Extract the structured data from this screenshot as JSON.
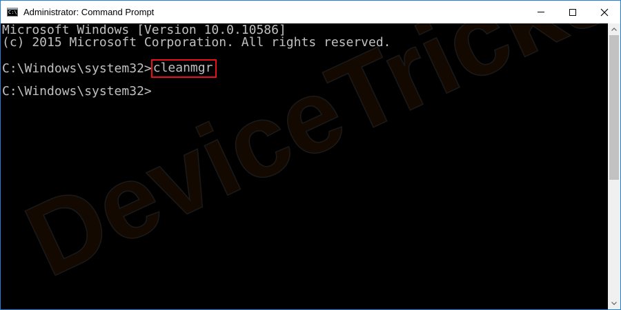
{
  "window": {
    "title": "Administrator: Command Prompt",
    "icon": "command-prompt-icon",
    "icon_glyph": "C:\\",
    "controls": [
      "minimize-icon",
      "maximize-icon",
      "close-icon"
    ]
  },
  "console": {
    "lines": [
      "Microsoft Windows [Version 10.0.10586]",
      "(c) 2015 Microsoft Corporation. All rights reserved.",
      "C:\\Windows\\system32>",
      "C:\\Windows\\system32>"
    ],
    "command": "cleanmgr",
    "text_color": "#c0c0c0",
    "background_color": "#000000",
    "highlight_color": "#e8101a"
  },
  "watermark": {
    "text": "DeviceTricks"
  },
  "scrollbar": {
    "icons": [
      "chevron-up-icon",
      "chevron-down-icon"
    ]
  }
}
